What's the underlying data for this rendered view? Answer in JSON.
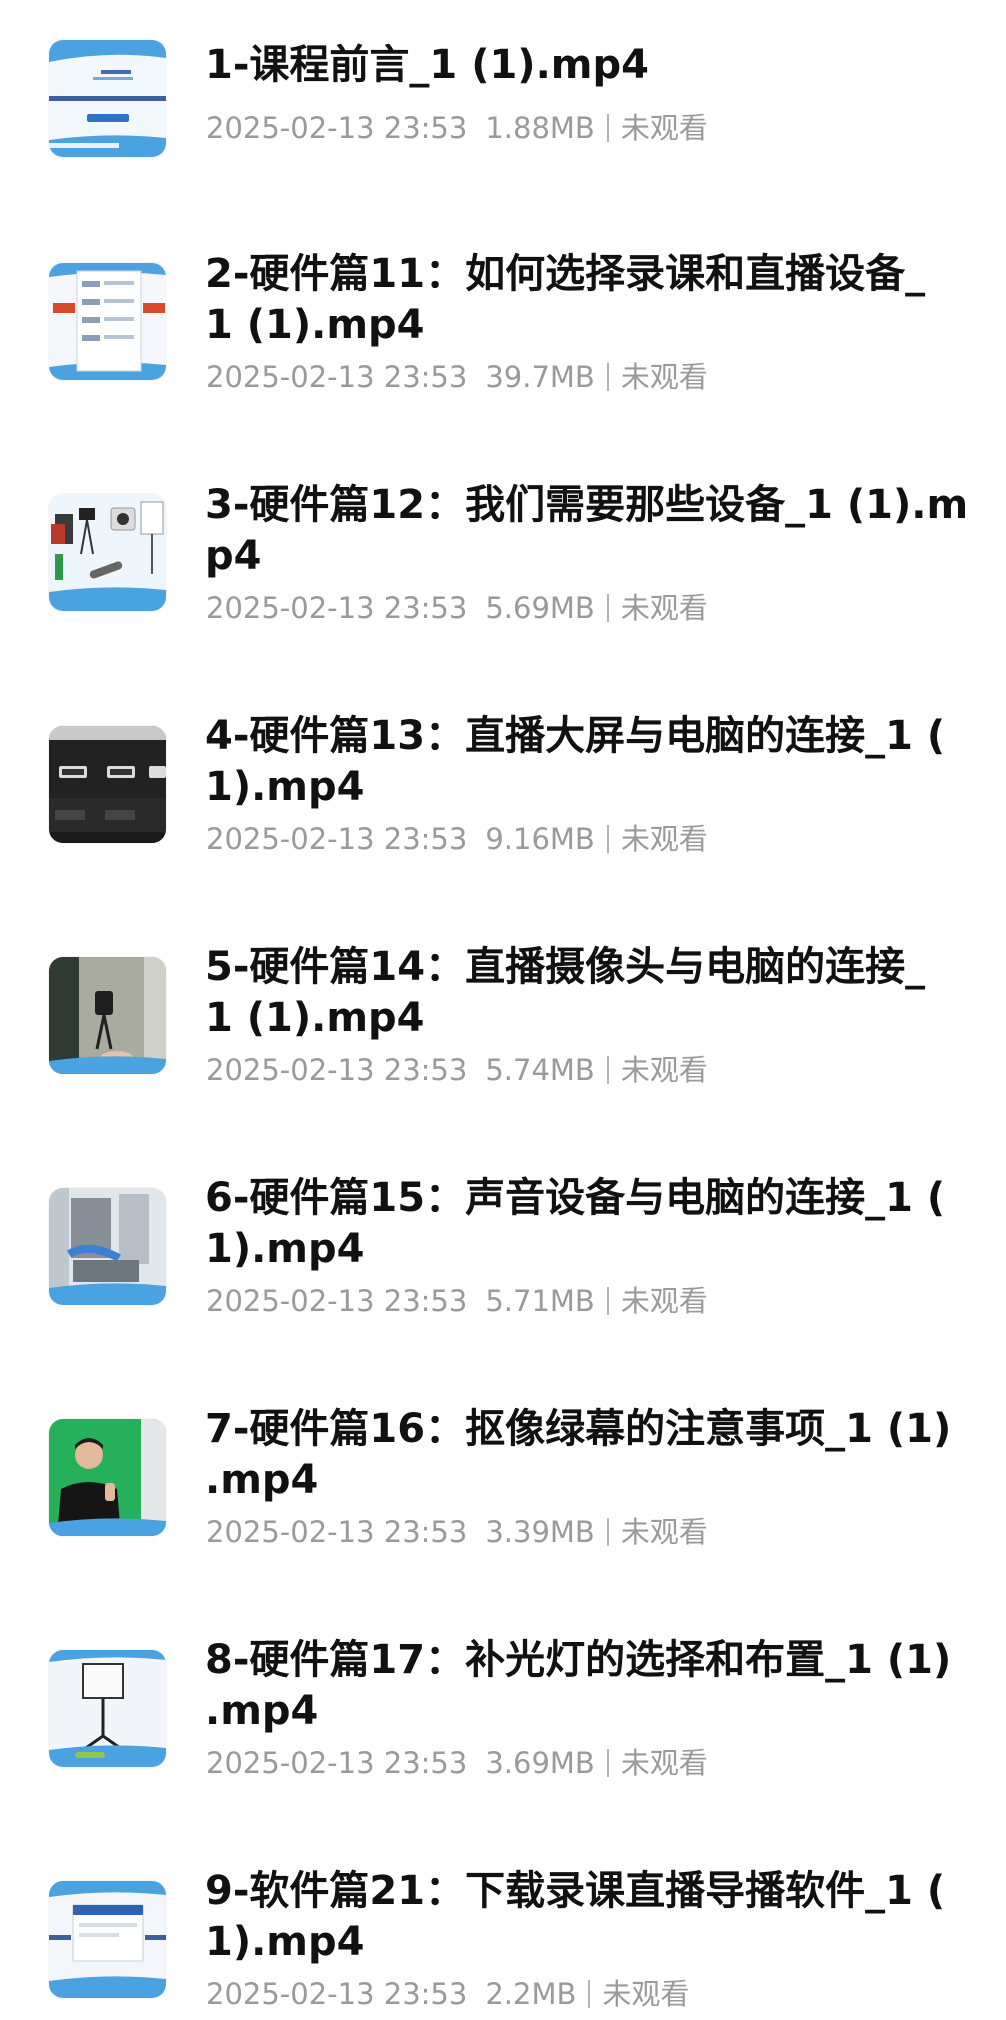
{
  "files": [
    {
      "title_lines": [
        "1-课程前言_1 (1).mp4"
      ],
      "date": "2025-02-13 23:53",
      "size": "1.88MB",
      "status": "未观看",
      "thumb": "slide-blue-icon"
    },
    {
      "title_lines": [
        "2-硬件篇11：如何选择录课和直播设备_",
        "1 (1).mp4"
      ],
      "date": "2025-02-13 23:53",
      "size": "39.7MB",
      "status": "未观看",
      "thumb": "slide-list-icon"
    },
    {
      "title_lines": [
        "3-硬件篇12：我们需要那些设备_1 (1).m",
        "p4"
      ],
      "date": "2025-02-13 23:53",
      "size": "5.69MB",
      "status": "未观看",
      "thumb": "devices-icon"
    },
    {
      "title_lines": [
        "4-硬件篇13：直播大屏与电脑的连接_1 (",
        "1).mp4"
      ],
      "date": "2025-02-13 23:53",
      "size": "9.16MB",
      "status": "未观看",
      "thumb": "hdmi-ports-icon"
    },
    {
      "title_lines": [
        "5-硬件篇14：直播摄像头与电脑的连接_",
        "1 (1).mp4"
      ],
      "date": "2025-02-13 23:53",
      "size": "5.74MB",
      "status": "未观看",
      "thumb": "camera-video-icon"
    },
    {
      "title_lines": [
        "6-硬件篇15：声音设备与电脑的连接_1 (",
        "1).mp4"
      ],
      "date": "2025-02-13 23:53",
      "size": "5.71MB",
      "status": "未观看",
      "thumb": "audio-device-icon"
    },
    {
      "title_lines": [
        "7-硬件篇16：抠像绿幕的注意事项_1 (1)",
        ".mp4"
      ],
      "date": "2025-02-13 23:53",
      "size": "3.39MB",
      "status": "未观看",
      "thumb": "green-screen-icon"
    },
    {
      "title_lines": [
        "8-硬件篇17：补光灯的选择和布置_1 (1)",
        ".mp4"
      ],
      "date": "2025-02-13 23:53",
      "size": "3.69MB",
      "status": "未观看",
      "thumb": "softbox-light-icon"
    },
    {
      "title_lines": [
        "9-软件篇21：下载录课直播导播软件_1 (",
        "1).mp4"
      ],
      "date": "2025-02-13 23:53",
      "size": "2.2MB",
      "status": "未观看",
      "thumb": "software-window-icon"
    }
  ]
}
